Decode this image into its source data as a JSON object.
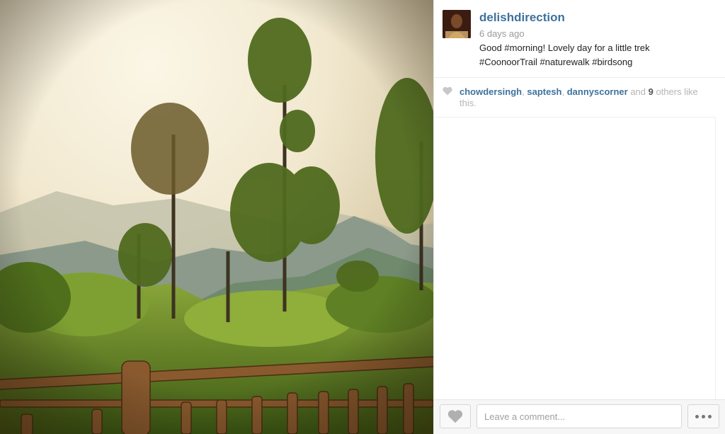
{
  "photo": {
    "description_icon": "landscape-photo",
    "colors": {
      "sky": "#f3ecd6",
      "hills": "#8a9a8a",
      "foliage": "#6f8f2a",
      "fence": "#8a5a2e"
    }
  },
  "post": {
    "username": "delishdirection",
    "timestamp": "6 days ago",
    "caption_line1": "Good #morning! Lovely day for a little trek",
    "caption_line2": "#CoonoorTrail #naturewalk #birdsong"
  },
  "likes": {
    "users": [
      "chowdersingh",
      "saptesh",
      "dannyscorner"
    ],
    "sep1": ", ",
    "sep2": ", ",
    "and_text": " and ",
    "others_count": "9",
    "suffix": " others like this."
  },
  "footer": {
    "comment_placeholder": "Leave a comment...",
    "like_icon": "heart-icon",
    "more_icon": "more-icon"
  },
  "colors": {
    "link": "#3f729b",
    "muted": "#999999",
    "heart": "#c8c8c8"
  }
}
